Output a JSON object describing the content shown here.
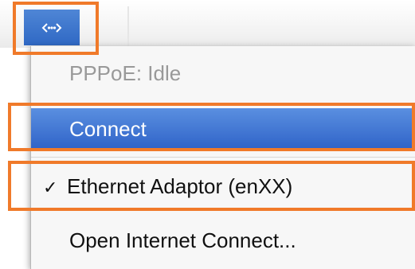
{
  "status_menu": {
    "icon": "network-connection-icon",
    "items": {
      "status": "PPPoE: Idle",
      "connect": "Connect",
      "ethernet": {
        "check": "✓",
        "label": "Ethernet Adaptor (enXX)"
      },
      "open": "Open Internet Connect..."
    }
  },
  "colors": {
    "selection": "#2f63c8",
    "annotation": "#f07a2a",
    "disabled_text": "#999999"
  }
}
